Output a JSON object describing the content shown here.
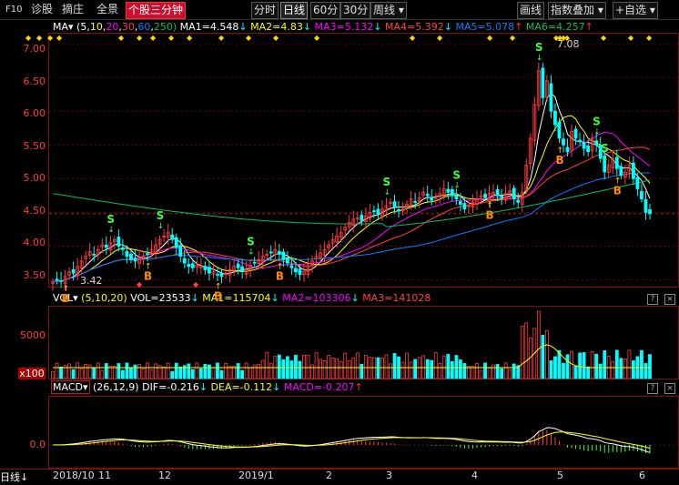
{
  "toolbar": {
    "left": [
      "F10",
      "诊股",
      "摘庄",
      "全景"
    ],
    "active_tab": "个股三分钟",
    "periods": [
      "分时",
      "日线",
      "60分",
      "30分"
    ],
    "selected_period": "日线",
    "period_dropdown": "周线",
    "right": [
      "画线",
      "指数叠加",
      "+自选"
    ]
  },
  "ma_legend": {
    "label": "MA",
    "params_prefix": "(5,",
    "p10": "10",
    "p20": "20",
    "p30": "30",
    "p60": "60",
    "p250": "250)",
    "ma1": "MA1=4.548",
    "ma2": "MA2=4.83",
    "ma3": "MA3=5.132",
    "ma4": "MA4=5.392",
    "ma5": "MA5=5.078",
    "ma6": "MA6=4.257"
  },
  "price_axis": {
    "labels": [
      "7.00",
      "6.50",
      "6.00",
      "5.50",
      "5.00",
      "4.50",
      "4.00",
      "3.50"
    ],
    "high_label": "7.08",
    "low_label": "3.42",
    "ylim": [
      3.4,
      7.15
    ]
  },
  "vol_legend": {
    "label": "VOL",
    "params": "(5,10,20)",
    "vol": "VOL=23533",
    "ma1": "MA1=115704",
    "ma2": "MA2=103306",
    "ma3": "MA3=141028"
  },
  "vol_axis": {
    "labels": [
      "5000",
      "x100"
    ]
  },
  "macd_legend": {
    "label": "MACD",
    "params": "(26,12,9)",
    "dif": "DIF=-0.216",
    "dea": "DEA=-0.112",
    "macd": "MACD=-0.207"
  },
  "macd_axis": {
    "labels": [
      "0.0"
    ]
  },
  "xaxis": {
    "period_label": "日线",
    "labels": [
      "2018/10",
      "11",
      "12",
      "2019/1",
      "2",
      "3",
      "4",
      "5",
      "6"
    ]
  },
  "window_buttons": [
    "?",
    "×"
  ],
  "signals": {
    "buy": "B",
    "sell": "S"
  },
  "colors": {
    "up": "#ff3c3c",
    "down": "#00ffff",
    "ma5": "#ffffff",
    "ma10": "#ffff00",
    "ma20": "#ff00ff",
    "ma30": "#ff4040",
    "ma60": "#0080ff",
    "ma250": "#00c060",
    "accent": "#c8102e"
  },
  "chart_data": {
    "type": "candlestick",
    "x_start": "2018/10",
    "ylim": [
      3.4,
      7.15
    ],
    "closes": [
      3.47,
      3.5,
      3.48,
      3.55,
      3.62,
      3.6,
      3.7,
      3.78,
      3.85,
      3.92,
      3.88,
      3.95,
      4.02,
      3.98,
      4.05,
      4.1,
      4.0,
      3.95,
      3.85,
      3.8,
      3.78,
      3.82,
      3.85,
      3.88,
      3.95,
      4.02,
      4.1,
      4.15,
      4.2,
      4.1,
      3.98,
      3.85,
      3.75,
      3.7,
      3.68,
      3.72,
      3.7,
      3.65,
      3.6,
      3.62,
      3.58,
      3.55,
      3.6,
      3.65,
      3.7,
      3.68,
      3.62,
      3.65,
      3.72,
      3.75,
      3.8,
      3.85,
      3.88,
      3.9,
      3.95,
      3.88,
      3.8,
      3.75,
      3.68,
      3.62,
      3.58,
      3.62,
      3.7,
      3.78,
      3.85,
      3.9,
      3.95,
      4.02,
      4.1,
      4.15,
      4.2,
      4.28,
      4.35,
      4.4,
      4.42,
      4.38,
      4.45,
      4.5,
      4.52,
      4.48,
      4.55,
      4.6,
      4.65,
      4.58,
      4.52,
      4.55,
      4.62,
      4.7,
      4.65,
      4.72,
      4.8,
      4.75,
      4.68,
      4.72,
      4.78,
      4.85,
      4.8,
      4.75,
      4.7,
      4.62,
      4.55,
      4.6,
      4.65,
      4.7,
      4.75,
      4.72,
      4.78,
      4.8,
      4.75,
      4.72,
      4.78,
      4.82,
      4.7,
      4.65,
      4.8,
      5.2,
      5.6,
      6.1,
      6.6,
      6.2,
      6.45,
      6.0,
      5.8,
      5.6,
      5.5,
      5.4,
      5.7,
      5.6,
      5.55,
      5.45,
      5.4,
      5.6,
      5.5,
      5.3,
      5.1,
      5.2,
      5.3,
      5.15,
      5.05,
      5.1,
      5.2,
      5.0,
      4.85,
      4.7,
      4.5,
      4.48
    ]
  }
}
